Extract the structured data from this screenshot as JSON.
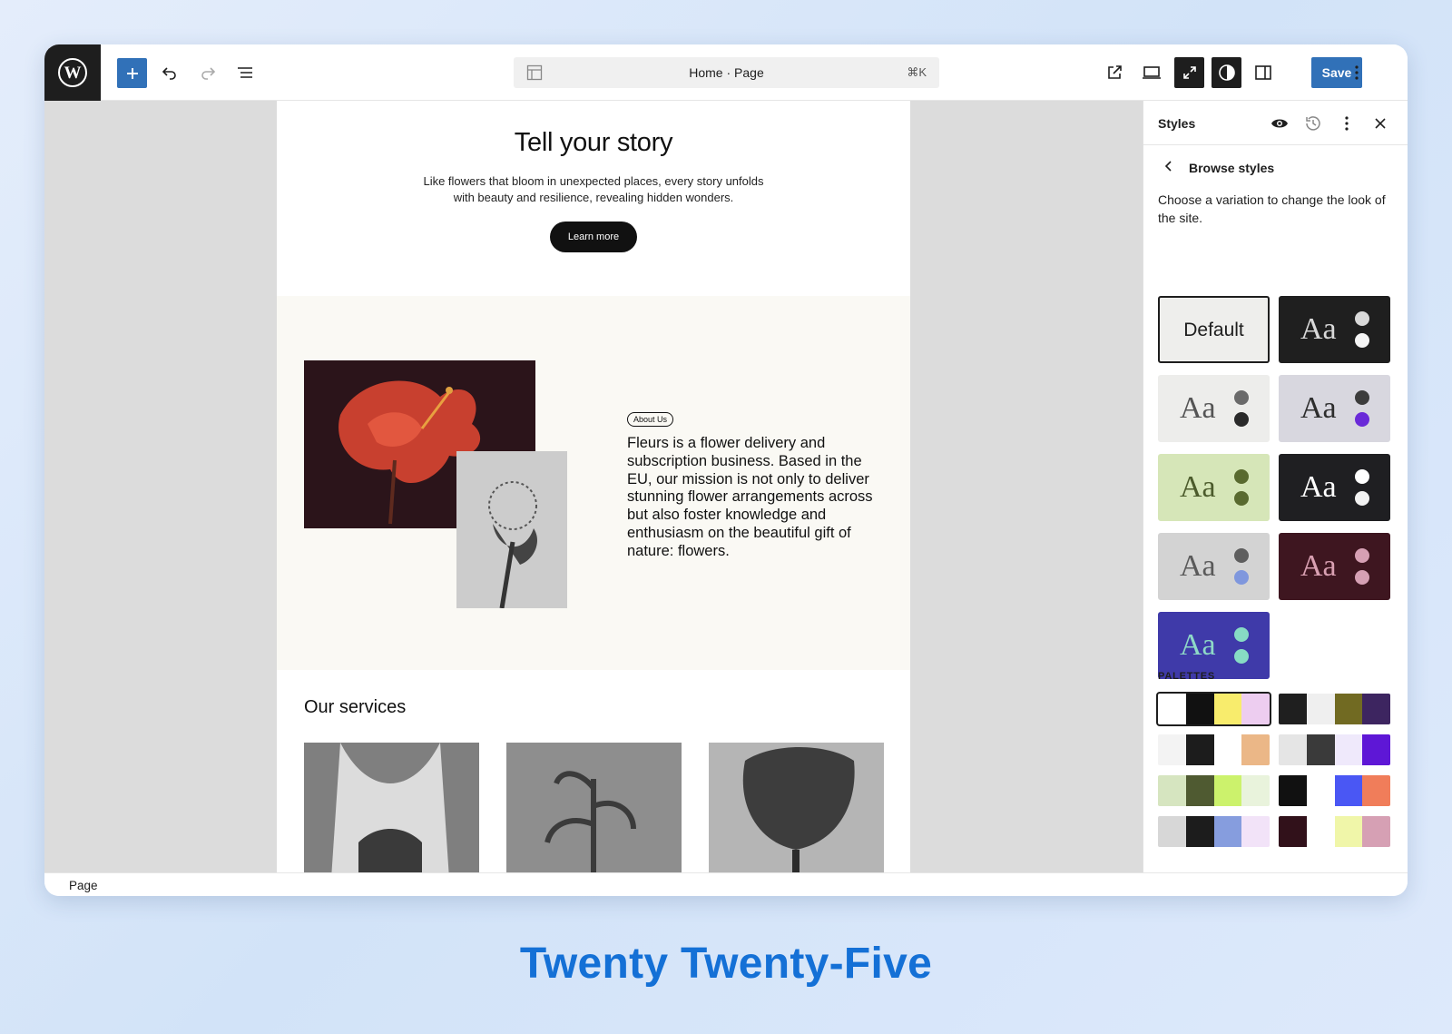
{
  "toolbar": {
    "document_title": "Home · Page",
    "shortcut": "⌘K",
    "save_label": "Save"
  },
  "hero": {
    "heading": "Tell your story",
    "text": "Like flowers that bloom in unexpected places, every story unfolds with beauty and resilience, revealing hidden wonders.",
    "button_label": "Learn more"
  },
  "about": {
    "pill": "About Us",
    "brand": "Fleurs",
    "text": " is a flower delivery and subscription business. Based in the EU, our mission is not only to deliver stunning flower arrangements across but also foster knowledge and enthusiasm on the beautiful gift of nature: flowers."
  },
  "services": {
    "heading": "Our services"
  },
  "sidebar": {
    "title": "Styles",
    "browse_title": "Browse styles",
    "description": "Choose a variation to change the look of the site.",
    "default_label": "Default",
    "aa_label": "Aa",
    "palettes_title": "PALETTES"
  },
  "variations": [
    {
      "bg": "#eeeeec",
      "fg": "#1e1e1e",
      "dot1": "",
      "dot2": "",
      "default": true
    },
    {
      "bg": "#1f1f1f",
      "fg": "#d9d9d9",
      "dot1": "#d9d9d9",
      "dot2": "#f5f5f5"
    },
    {
      "bg": "#ededeb",
      "fg": "#555555",
      "dot1": "#6a6a6a",
      "dot2": "#2a2a2a"
    },
    {
      "bg": "#d8d7df",
      "fg": "#2d2d2d",
      "dot1": "#3c3c3c",
      "dot2": "#6a2ad8"
    },
    {
      "bg": "#d6e6b8",
      "fg": "#4c5b2c",
      "dot1": "#596a2f",
      "dot2": "#596a2f"
    },
    {
      "bg": "#1f1f22",
      "fg": "#ffffff",
      "dot1": "#ffffff",
      "dot2": "#f2f2f2"
    },
    {
      "bg": "#d3d3d3",
      "fg": "#5a5a5a",
      "dot1": "#5e5e5e",
      "dot2": "#7f97dd"
    },
    {
      "bg": "#3e1620",
      "fg": "#d9a0b2",
      "dot1": "#d6a0b4",
      "dot2": "#d6a0b4"
    },
    {
      "bg": "#3f3aa9",
      "fg": "#8ed9c7",
      "dot1": "#87dbc4",
      "dot2": "#87dbc4"
    }
  ],
  "palettes": [
    [
      "#ffffff",
      "#111111",
      "#f8ec6c",
      "#edcdf0"
    ],
    [
      "#1f1f1f",
      "#efefef",
      "#716a22",
      "#3d2560"
    ],
    [
      "#f3f3f3",
      "#1c1c1c",
      "#ffffff",
      "#ebb787"
    ],
    [
      "#e5e5e5",
      "#3a3a3a",
      "#efe9fb",
      "#5e17d6"
    ],
    [
      "#d6e5c0",
      "#4f5a31",
      "#ccf26c",
      "#e9f3dc"
    ],
    [
      "#111111",
      "#ffffff",
      "#4a57f4",
      "#f07d5a"
    ],
    [
      "#d7d7d7",
      "#1c1c1c",
      "#869dde",
      "#f2e3f8"
    ],
    [
      "#31111a",
      "#ffffff",
      "#f0f6a9",
      "#d6a0b4"
    ]
  ],
  "status": {
    "breadcrumb": "Page"
  },
  "caption": "Twenty Twenty-Five"
}
